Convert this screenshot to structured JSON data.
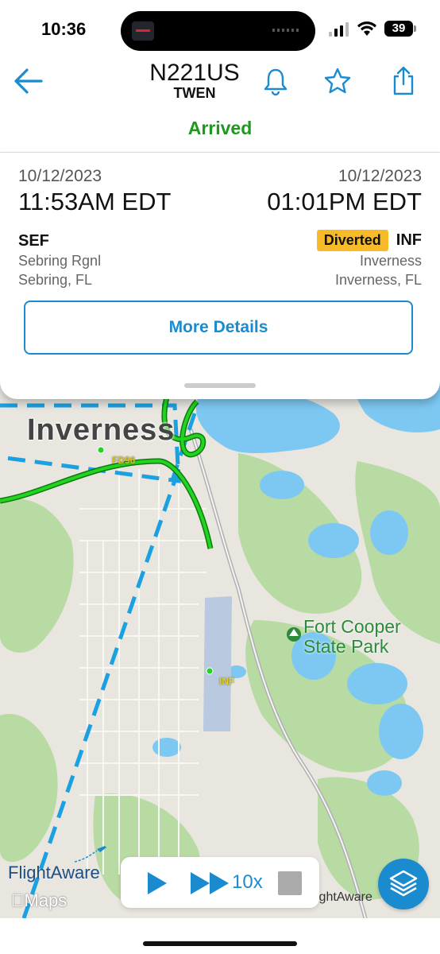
{
  "status_bar": {
    "time": "10:36",
    "battery": "39"
  },
  "nav": {
    "registration": "N221US",
    "aircraft_type": "TWEN"
  },
  "flight_status": "Arrived",
  "departure": {
    "date": "10/12/2023",
    "time": "11:53AM EDT",
    "code": "SEF",
    "airport": "Sebring Rgnl",
    "city": "Sebring, FL"
  },
  "arrival": {
    "date": "10/12/2023",
    "time": "01:01PM EDT",
    "badge": "Diverted",
    "code": "INF",
    "airport": "Inverness",
    "city": "Inverness, FL"
  },
  "more_details_label": "More Details",
  "map": {
    "city_label": "Inverness",
    "fd_label": "FD96",
    "inf_label": "INF",
    "park_line1": "Fort Cooper",
    "park_line2": "State Park",
    "flightaware_logo": "FlightAware",
    "apple_maps": "Maps",
    "flightaware_small": "ightAware"
  },
  "player": {
    "speed": "10x"
  },
  "colors": {
    "accent": "#1b8bd0",
    "arrived_green": "#1d9a1d",
    "diverted_badge": "#f7bb2a",
    "track_green": "#22d322"
  }
}
